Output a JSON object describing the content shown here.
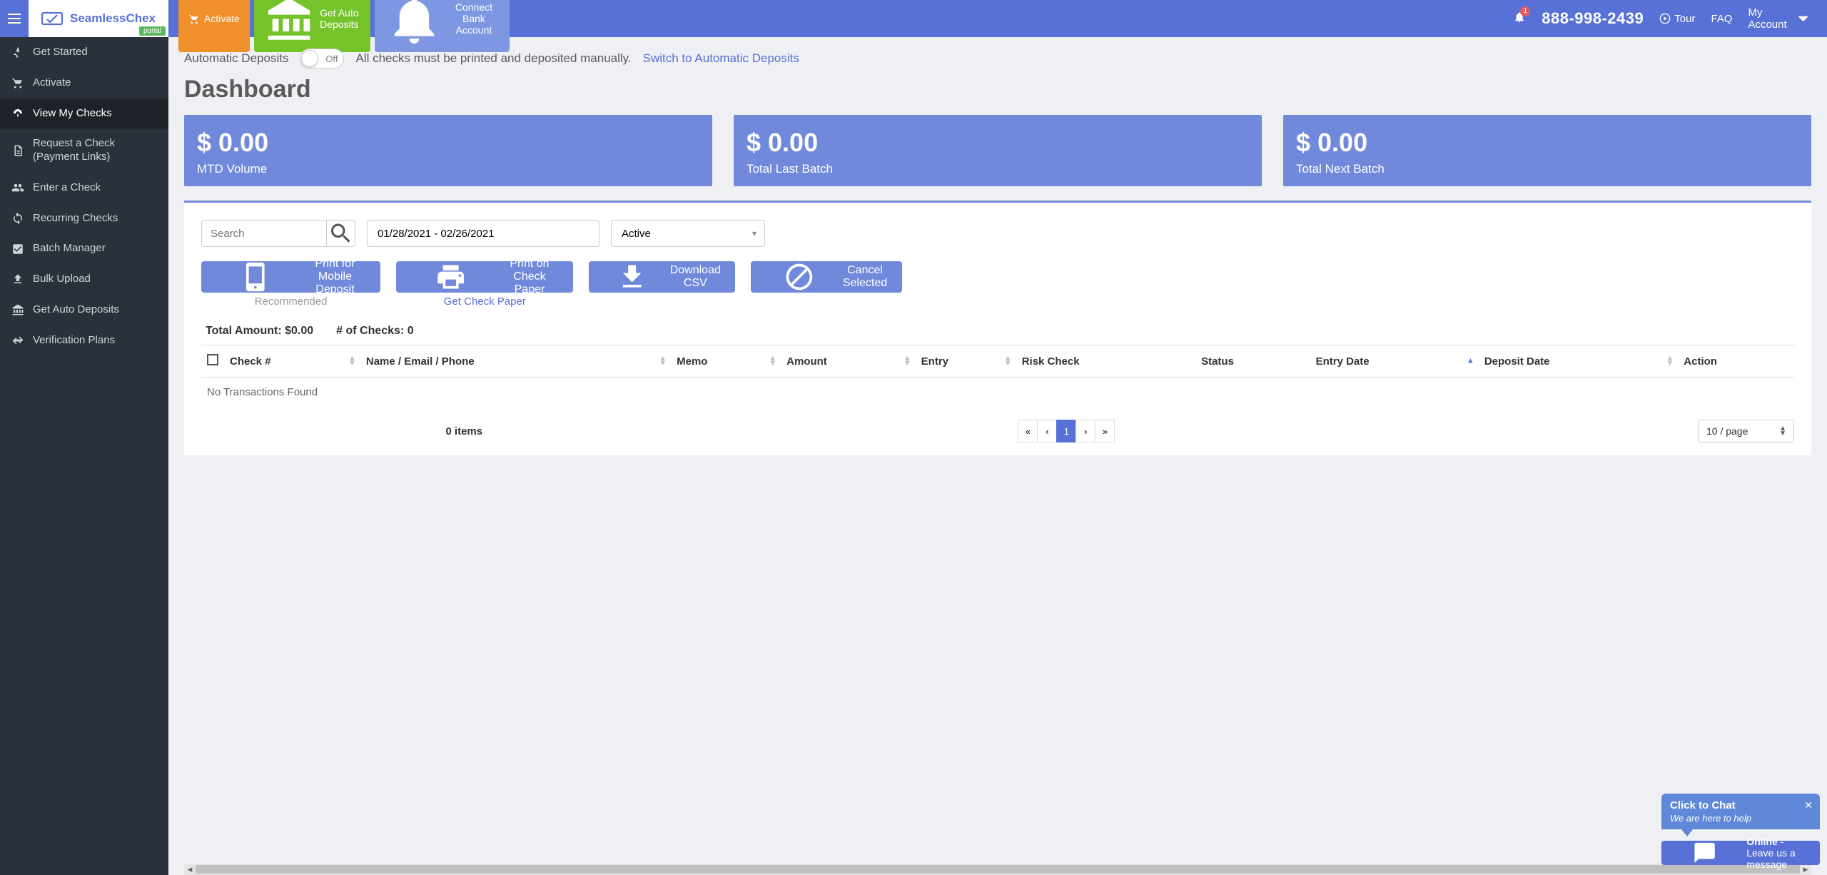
{
  "brand": {
    "name1": "Seamless",
    "name2": "Chex",
    "portal_badge": "portal"
  },
  "topbar": {
    "activate": "Activate",
    "auto_deposits": "Get Auto Deposits",
    "connect_bank": "Connect Bank Account",
    "bell_count": "1",
    "phone": "888-998-2439",
    "tour": "Tour",
    "faq": "FAQ",
    "account": "My Account"
  },
  "sidebar": {
    "items": [
      {
        "label": "Get Started"
      },
      {
        "label": "Activate"
      },
      {
        "label": "View My Checks"
      },
      {
        "label": "Request a Check (Payment Links)"
      },
      {
        "label": "Enter a Check"
      },
      {
        "label": "Recurring Checks"
      },
      {
        "label": "Batch Manager"
      },
      {
        "label": "Bulk Upload"
      },
      {
        "label": "Get Auto Deposits"
      },
      {
        "label": "Verification Plans"
      }
    ]
  },
  "auto": {
    "label": "Automatic Deposits",
    "toggle_state": "Off",
    "msg": "All checks must be printed and deposited manually.",
    "link": "Switch to Automatic Deposits"
  },
  "page_title": "Dashboard",
  "stats": [
    {
      "value": "$ 0.00",
      "label": "MTD Volume"
    },
    {
      "value": "$ 0.00",
      "label": "Total Last Batch"
    },
    {
      "value": "$ 0.00",
      "label": "Total Next Batch"
    }
  ],
  "filters": {
    "search_placeholder": "Search",
    "date_range": "01/28/2021 - 02/26/2021",
    "status_select": "Active"
  },
  "actions": {
    "print_mobile": "Print for Mobile Deposit",
    "print_mobile_sub": "Recommended",
    "print_paper": "Print on Check Paper",
    "print_paper_sub": "Get Check Paper",
    "download_csv": "Download CSV",
    "cancel_selected": "Cancel Selected"
  },
  "totals": {
    "amount_label": "Total Amount: $0.00",
    "count_label": "# of Checks: 0"
  },
  "table": {
    "h_check": "Check #",
    "h_name": "Name / Email / Phone",
    "h_memo": "Memo",
    "h_amount": "Amount",
    "h_entry": "Entry",
    "h_risk": "Risk Check",
    "h_status": "Status",
    "h_entrydate": "Entry Date",
    "h_depositdate": "Deposit Date",
    "h_action": "Action",
    "no_data": "No Transactions Found"
  },
  "footer": {
    "items": "0 items",
    "page": "1",
    "per_page": "10 / page"
  },
  "chat": {
    "title": "Click to Chat",
    "sub": "We are here to help",
    "online": "Online",
    "msg": " - Leave us a message"
  }
}
